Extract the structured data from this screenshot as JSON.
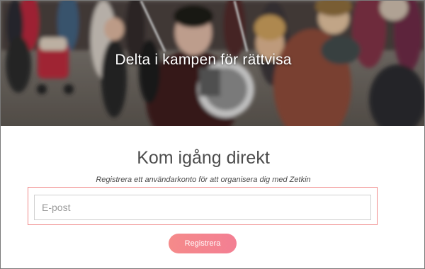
{
  "hero": {
    "title": "Delta i kampen för rättvisa"
  },
  "signup": {
    "heading": "Kom igång direkt",
    "subtitle": "Registrera ett användarkonto för att organisera dig med Zetkin",
    "email_placeholder": "E-post",
    "email_value": "",
    "submit_label": "Registrera"
  },
  "colors": {
    "accent": "#f4848e",
    "field_highlight": "#f08a8a",
    "heading_text": "#4d4d4d"
  }
}
